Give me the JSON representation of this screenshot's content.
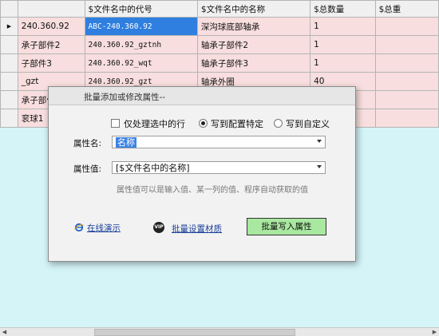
{
  "grid": {
    "columns": [
      "",
      "$文件名中的代号",
      "$文件名中的名称",
      "$总数量",
      "$总重"
    ],
    "rows": [
      [
        "240.360.92",
        "ABC-240.360.92",
        "深沟球底部轴承",
        "1",
        ""
      ],
      [
        "承子部件2",
        "240.360.92_gztnh",
        "轴承子部件2",
        "1",
        ""
      ],
      [
        "子部件3",
        "240.360.92_wqt",
        "轴承子部件3",
        "1",
        ""
      ],
      [
        "_gzt",
        "240.360.92_gzt",
        "轴承外圈",
        "40",
        ""
      ],
      [
        "承子部件",
        "",
        "",
        "",
        ""
      ],
      [
        "衮球1",
        "",
        "",
        "",
        ""
      ]
    ]
  },
  "dialog": {
    "title": "批量添加或修改属性--",
    "opt_selected_only": "仅处理选中的行",
    "opt_write_config": "写到配置特定",
    "opt_write_custom": "写到自定义",
    "attr_name_label": "属性名:",
    "attr_name_value": "名称",
    "attr_value_label": "属性值:",
    "attr_value_value": "[$文件名中的名称]",
    "hint": "属性值可以是输入值、某一列的值、程序自动获取的值",
    "link_demo": "在线演示",
    "link_material": "批量设置材质",
    "btn_write": "批量写入属性",
    "vip_badge": "VIP",
    "icon_demo": "ie-icon"
  }
}
